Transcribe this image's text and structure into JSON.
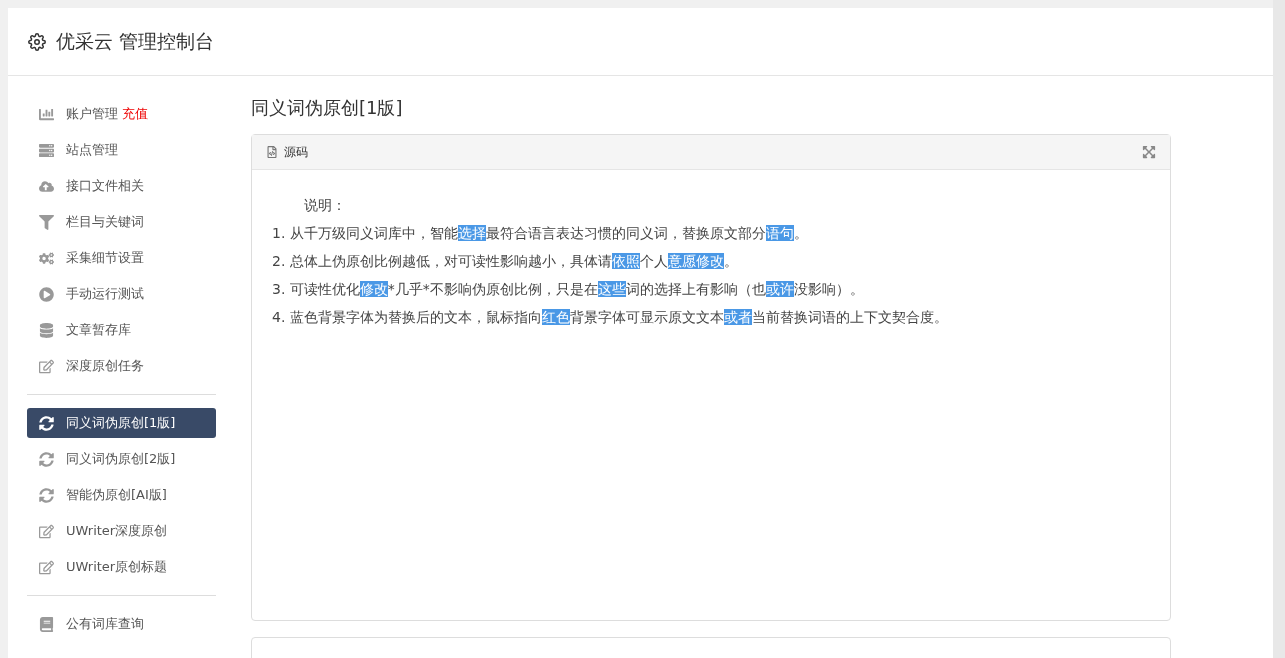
{
  "header": {
    "title": "优采云 管理控制台"
  },
  "sidebar": {
    "groups": [
      {
        "items": [
          {
            "kind": "chart",
            "label": "账户管理",
            "badge": "充值",
            "selected": false
          },
          {
            "kind": "server",
            "label": "站点管理",
            "selected": false
          },
          {
            "kind": "upload",
            "label": "接口文件相关",
            "selected": false
          },
          {
            "kind": "filter",
            "label": "栏目与关键词",
            "selected": false
          },
          {
            "kind": "gears",
            "label": "采集细节设置",
            "selected": false
          },
          {
            "kind": "play",
            "label": "手动运行测试",
            "selected": false
          },
          {
            "kind": "database",
            "label": "文章暂存库",
            "selected": false
          },
          {
            "kind": "edit",
            "label": "深度原创任务",
            "selected": false
          }
        ]
      },
      {
        "items": [
          {
            "kind": "sync",
            "label": "同义词伪原创[1版]",
            "selected": true
          },
          {
            "kind": "sync",
            "label": "同义词伪原创[2版]",
            "selected": false
          },
          {
            "kind": "sync",
            "label": "智能伪原创[AI版]",
            "selected": false
          },
          {
            "kind": "edit",
            "label": "UWriter深度原创",
            "selected": false
          },
          {
            "kind": "edit",
            "label": "UWriter原创标题",
            "selected": false
          }
        ]
      },
      {
        "items": [
          {
            "kind": "book",
            "label": "公有词库查询",
            "selected": false
          }
        ]
      }
    ]
  },
  "page_title": "同义词伪原创[1版]",
  "editor": {
    "toolbar_label": "源码",
    "lines": [
      {
        "kind": "heading",
        "segments": [
          {
            "text": "说明：",
            "highlighted": false
          }
        ]
      },
      {
        "kind": "item",
        "segments": [
          {
            "text": "1. 从千万级同义词库中，智能",
            "highlighted": false
          },
          {
            "text": "选择",
            "highlighted": true
          },
          {
            "text": "最符合语言表达习惯的同义词，替换原文部分",
            "highlighted": false
          },
          {
            "text": "语句",
            "highlighted": true
          },
          {
            "text": "。",
            "highlighted": false
          }
        ]
      },
      {
        "kind": "item",
        "segments": [
          {
            "text": "2. 总体上伪原创比例越低，对可读性影响越小，具体请",
            "highlighted": false
          },
          {
            "text": "依照",
            "highlighted": true
          },
          {
            "text": "个人",
            "highlighted": false
          },
          {
            "text": "意愿",
            "highlighted": true
          },
          {
            "text": "修改",
            "highlighted": true
          },
          {
            "text": "。",
            "highlighted": false
          }
        ]
      },
      {
        "kind": "item",
        "segments": [
          {
            "text": "3. 可读性优化",
            "highlighted": false
          },
          {
            "text": "修改",
            "highlighted": true
          },
          {
            "text": "*几乎*不影响伪原创比例，只是在",
            "highlighted": false
          },
          {
            "text": "这些",
            "highlighted": true
          },
          {
            "text": "词的选择上有影响（也",
            "highlighted": false
          },
          {
            "text": "或许",
            "highlighted": true
          },
          {
            "text": "没影响）。",
            "highlighted": false
          }
        ]
      },
      {
        "kind": "item",
        "segments": [
          {
            "text": "4. 蓝色背景字体为替换后的文本，鼠标指向",
            "highlighted": false
          },
          {
            "text": "红色",
            "highlighted": true
          },
          {
            "text": "背景字体可显示原文文本",
            "highlighted": false
          },
          {
            "text": "或者",
            "highlighted": true
          },
          {
            "text": "当前替换词语的上下文契合度。",
            "highlighted": false
          }
        ]
      }
    ]
  }
}
